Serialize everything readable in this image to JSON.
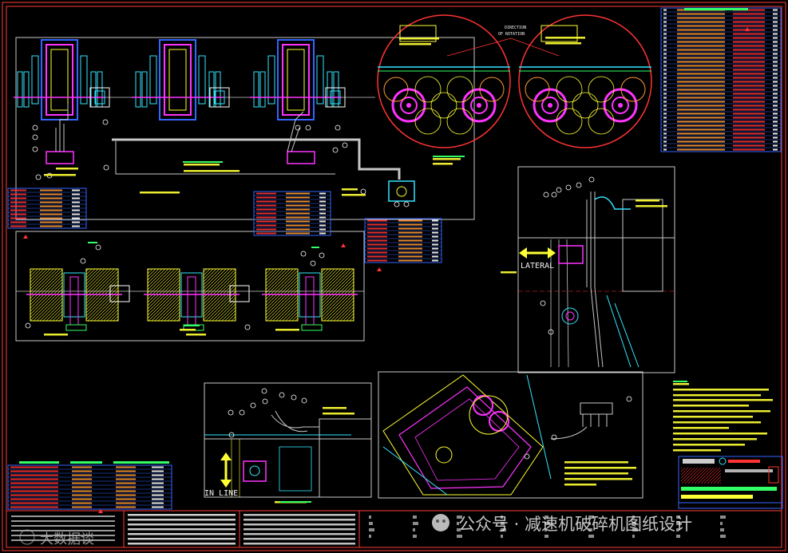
{
  "drawing": {
    "labels": {
      "direction": "DIRECTION",
      "of_rotation": "OF ROTATION",
      "lateral": "LATERAL",
      "in_line": "IN LINE"
    }
  },
  "watermark": {
    "left_text": "大数据谈",
    "right_text": "公众号 · 减速机破碎机图纸设计"
  },
  "colors": {
    "background": "#000000",
    "border": "#ff3b3b",
    "gray_line": "#c8c8c8",
    "magenta": "#ff33ff",
    "cyan": "#33e6ff",
    "yellow": "#ffff33",
    "green": "#33ff66",
    "blue": "#3366ff",
    "red": "#ff3333",
    "orange": "#ff9933"
  },
  "icons": {
    "left_arrow": "double-headed-horizontal-arrow-icon",
    "vertical_arrow": "double-headed-vertical-arrow-icon",
    "wechat": "wechat-icon"
  }
}
